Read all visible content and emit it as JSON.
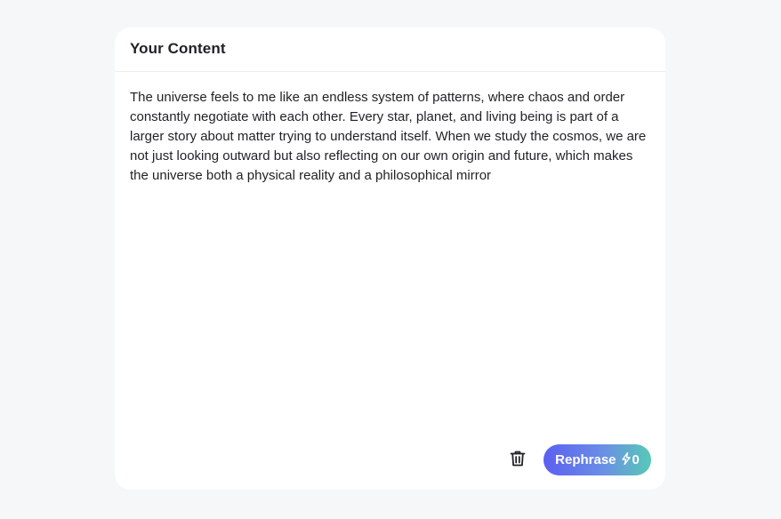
{
  "card": {
    "title": "Your Content",
    "content": "The universe feels to me like an endless system of patterns, where chaos and order constantly negotiate with each other. Every star, planet, and living being is part of a larger story about matter trying to understand itself. When we study the cosmos, we are not just looking outward but also reflecting on our own origin and future, which makes the universe both a physical reality and a philosophical mirror"
  },
  "footer": {
    "delete_icon": "trash-icon",
    "rephrase_label": "Rephrase",
    "credit_icon": "lightning-icon",
    "credit_count": "0"
  },
  "colors": {
    "background": "#f6f7f9",
    "card": "#ffffff",
    "text": "#1f2126",
    "button_gradient_start": "#5b5ff0",
    "button_gradient_end": "#58c9b6"
  }
}
